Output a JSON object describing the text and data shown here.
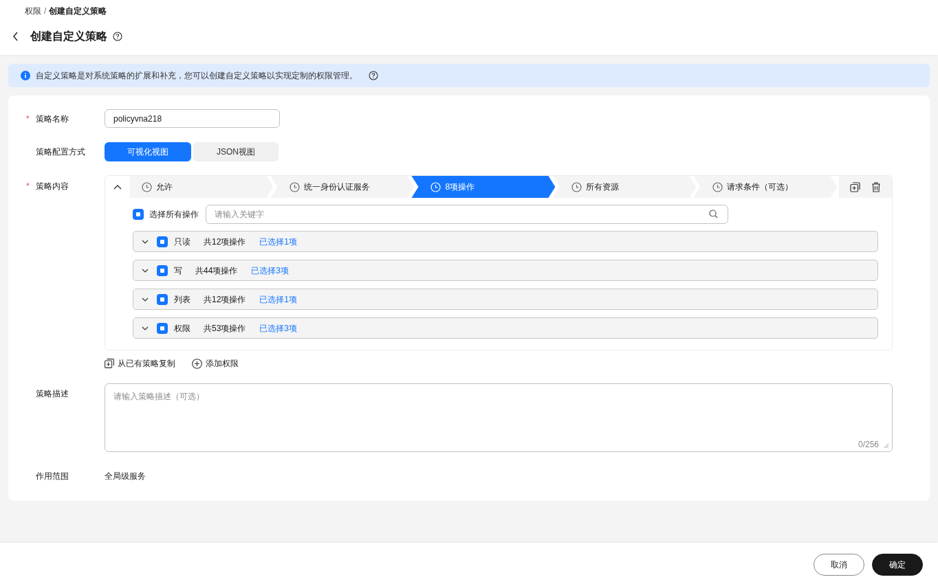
{
  "breadcrumb": {
    "parent": "权限",
    "separator": "/",
    "current": "创建自定义策略"
  },
  "title": "创建自定义策略",
  "info_banner": "自定义策略是对系统策略的扩展和补充，您可以创建自定义策略以实现定制的权限管理。",
  "form": {
    "name": {
      "label": "策略名称",
      "required_mark": "*",
      "value": "policyvna218"
    },
    "mode": {
      "label": "策略配置方式",
      "options": [
        {
          "label": "可视化视图",
          "selected": true
        },
        {
          "label": "JSON视图",
          "selected": false
        }
      ]
    },
    "content": {
      "label": "策略内容",
      "required_mark": "*",
      "expanded": true,
      "steps": [
        {
          "label": "允许",
          "selected": false
        },
        {
          "label": "统一身份认证服务",
          "selected": false
        },
        {
          "label": "8项操作",
          "selected": true
        },
        {
          "label": "所有资源",
          "selected": false
        },
        {
          "label": "请求条件（可选）",
          "selected": false
        }
      ],
      "select_all": {
        "label": "选择所有操作",
        "indeterminate": true
      },
      "search": {
        "placeholder": "请输入关键字"
      },
      "groups": [
        {
          "name": "只读",
          "total": "共12项操作",
          "selected_count": "已选择1项",
          "indeterminate": true,
          "expanded": false
        },
        {
          "name": "写",
          "total": "共44项操作",
          "selected_count": "已选择3项",
          "indeterminate": true,
          "expanded": false
        },
        {
          "name": "列表",
          "total": "共12项操作",
          "selected_count": "已选择1项",
          "indeterminate": true,
          "expanded": false
        },
        {
          "name": "权限",
          "total": "共53项操作",
          "selected_count": "已选择3项",
          "indeterminate": true,
          "expanded": false
        }
      ],
      "actions": [
        "从已有策略复制",
        "添加权限"
      ]
    },
    "description": {
      "label": "策略描述",
      "placeholder": "请输入策略描述（可选）",
      "counter": "0/256"
    },
    "scope": {
      "label": "作用范围",
      "value": "全局级服务"
    }
  },
  "buttons": [
    {
      "label": "取消",
      "kind": "secondary"
    },
    {
      "label": "确定",
      "kind": "primary"
    }
  ]
}
